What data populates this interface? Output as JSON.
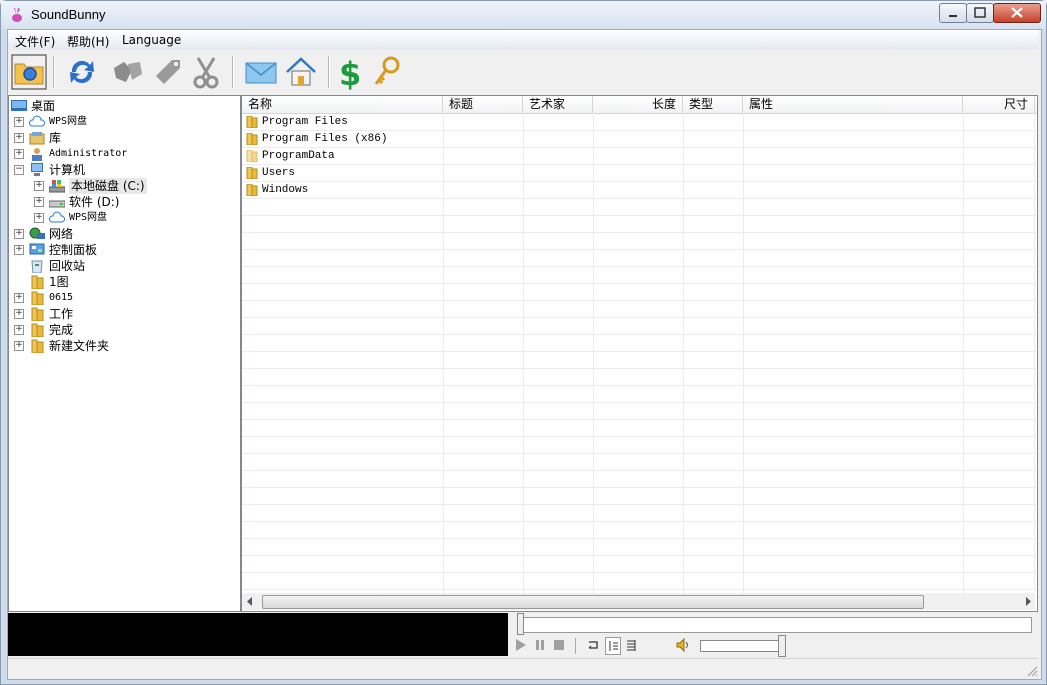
{
  "window": {
    "title": "SoundBunny"
  },
  "menubar": {
    "items": [
      {
        "label": "文件(F)"
      },
      {
        "label": "帮助(H)"
      },
      {
        "label": "Language"
      }
    ]
  },
  "toolbar": {
    "buttons": [
      "open-folder-icon",
      "refresh-icon",
      "tag-icon",
      "tag-edit-icon",
      "cut-icon",
      "mail-icon",
      "home-icon",
      "dollar-icon",
      "key-icon"
    ]
  },
  "tree": {
    "items": [
      {
        "label": "桌面"
      },
      {
        "label": "WPS网盘"
      },
      {
        "label": "库"
      },
      {
        "label": "Administrator"
      },
      {
        "label": "计算机"
      },
      {
        "label": "本地磁盘 (C:)"
      },
      {
        "label": "软件 (D:)"
      },
      {
        "label": "WPS网盘"
      },
      {
        "label": "网络"
      },
      {
        "label": "控制面板"
      },
      {
        "label": "回收站"
      },
      {
        "label": "1图"
      },
      {
        "label": "0615"
      },
      {
        "label": "工作"
      },
      {
        "label": "完成"
      },
      {
        "label": "新建文件夹"
      }
    ]
  },
  "list": {
    "columns": [
      "名称",
      "标题",
      "艺术家",
      "长度",
      "类型",
      "属性",
      "尺寸"
    ],
    "rows": [
      {
        "name": "Program Files"
      },
      {
        "name": "Program Files (x86)"
      },
      {
        "name": "ProgramData"
      },
      {
        "name": "Users"
      },
      {
        "name": "Windows"
      }
    ]
  },
  "colors": {
    "accent": "#1f6fd1",
    "folder": "#e8c24a"
  }
}
